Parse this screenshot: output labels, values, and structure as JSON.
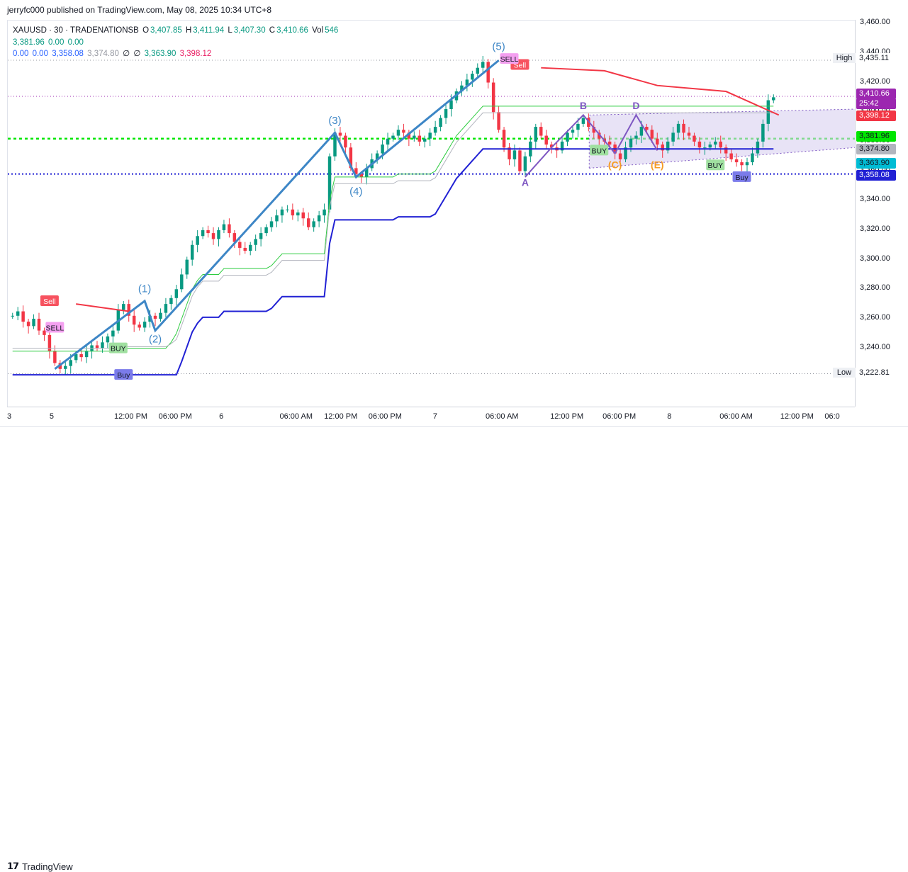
{
  "header": {
    "published": "jerryfc000 published on TradingView.com, May 08, 2025 10:34 UTC+8"
  },
  "legend": {
    "symbol": "XAUUSD · 30 · TRADENATIONSB",
    "open_label": "O",
    "open": "3,407.85",
    "high_label": "H",
    "high": "3,411.94",
    "low_label": "L",
    "low": "3,407.30",
    "close_label": "C",
    "close": "3,410.66",
    "vol_label": "Vol",
    "vol": "546",
    "row2": [
      "3,381.96",
      "0.00",
      "0.00"
    ],
    "row3": [
      "0.00",
      "0.00",
      "3,358.08",
      "3,374.80",
      "∅",
      "∅",
      "3,363.90",
      "3,398.12"
    ]
  },
  "footer": {
    "brand": "TradingView"
  },
  "price_tags": {
    "high_label": "High",
    "high_value": "3,435.11",
    "low_label": "Low",
    "low_value": "3,222.81",
    "current": "3,410.66",
    "countdown": "25:42",
    "red_level": "3,398.12",
    "green_level": "3,381.96",
    "gray_level": "3,374.80",
    "cyan_level": "3,363.90",
    "blue_level": "3,358.08"
  },
  "colors": {
    "up": "#089981",
    "down": "#f23645",
    "wave": "#3d86c6",
    "supertrend_red": "#f23645",
    "supertrend_blue": "#2121d4",
    "green_line": "#2ecc40",
    "purple": "#9c27b0",
    "triangle_fill": "#d9d1f0",
    "orange": "#f59b23"
  },
  "chart_data": {
    "type": "candlestick",
    "symbol": "XAUUSD",
    "y_ticks": [
      3240,
      3260,
      3280,
      3300,
      3320,
      3340,
      3360,
      3380,
      3400,
      3420,
      3440,
      3460
    ],
    "y_tick_labels": [
      "3,240.00",
      "3,260.00",
      "3,280.00",
      "3,300.00",
      "3,320.00",
      "3,340.00",
      "3,360.00",
      "3,380.00",
      "3,400.00",
      "3,420.00",
      "3,440.00",
      "3,460.00"
    ],
    "ylim": [
      3200,
      3462
    ],
    "x_tick_labels": [
      "3",
      "5",
      "12:00 PM",
      "06:00 PM",
      "6",
      "06:00 AM",
      "12:00 PM",
      "06:00 PM",
      "7",
      "06:00 AM",
      "12:00 PM",
      "06:00 PM",
      "8",
      "06:00 AM",
      "12:00 PM",
      "06:0"
    ],
    "x_tick_bars": [
      2,
      13,
      29,
      40,
      55,
      70,
      81,
      92,
      108,
      121,
      137,
      150,
      166,
      179,
      194,
      205
    ],
    "bar_count": 210,
    "candles_ohlc_start": 3262,
    "candles_closes": [
      3262,
      3265,
      3258,
      3255,
      3260,
      3252,
      3249,
      3238,
      3230,
      3226,
      3228,
      3232,
      3236,
      3234,
      3238,
      3242,
      3240,
      3244,
      3248,
      3252,
      3266,
      3270,
      3262,
      3256,
      3254,
      3258,
      3262,
      3260,
      3264,
      3270,
      3274,
      3280,
      3290,
      3300,
      3310,
      3316,
      3320,
      3318,
      3314,
      3320,
      3324,
      3318,
      3312,
      3308,
      3306,
      3310,
      3314,
      3318,
      3322,
      3326,
      3330,
      3334,
      3334,
      3330,
      3332,
      3328,
      3322,
      3326,
      3330,
      3334,
      3370,
      3386,
      3384,
      3376,
      3362,
      3358,
      3356,
      3362,
      3368,
      3372,
      3378,
      3382,
      3384,
      3388,
      3386,
      3382,
      3384,
      3380,
      3382,
      3386,
      3390,
      3396,
      3402,
      3408,
      3414,
      3418,
      3422,
      3426,
      3430,
      3434,
      3420,
      3400,
      3388,
      3376,
      3368,
      3374,
      3360,
      3370,
      3380,
      3390,
      3384,
      3378,
      3376,
      3374,
      3380,
      3386,
      3388,
      3392,
      3396,
      3390,
      3386,
      3382,
      3380,
      3378,
      3372,
      3368,
      3376,
      3382,
      3384,
      3390,
      3388,
      3382,
      3378,
      3374,
      3380,
      3386,
      3392,
      3386,
      3384,
      3380,
      3376,
      3376,
      3378,
      3380,
      3376,
      3372,
      3368,
      3366,
      3364,
      3366,
      3372,
      3380,
      3392,
      3408,
      3410
    ],
    "wave_labels": [
      "(1)",
      "(2)",
      "(3)",
      "(4)",
      "(5)"
    ],
    "pattern_labels": [
      "A",
      "B",
      "(C)",
      "D",
      "(E)"
    ],
    "signals": {
      "sell": "Sell",
      "SELL": "SELL",
      "buy": "Buy",
      "BUY": "BUY"
    }
  }
}
